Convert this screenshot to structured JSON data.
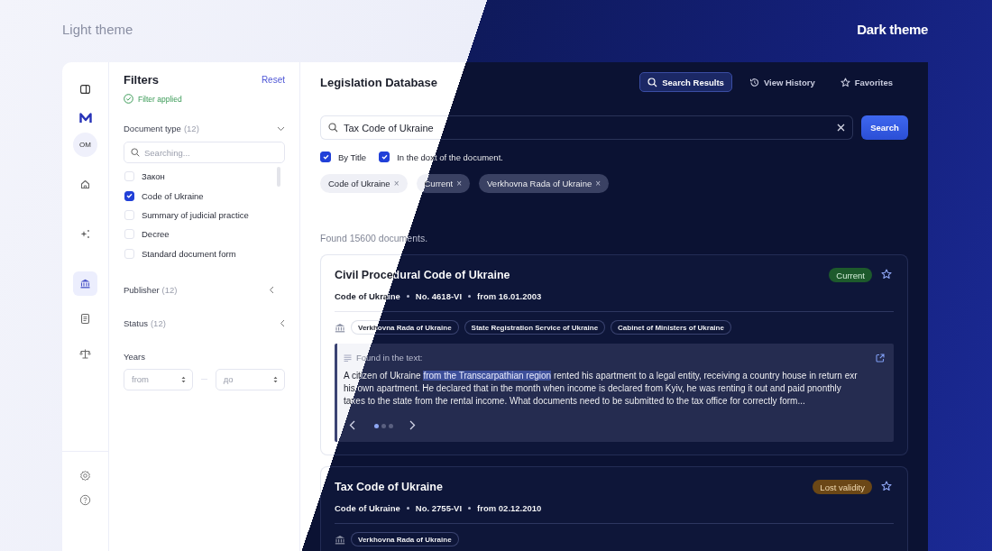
{
  "theme_labels": [
    "Light theme",
    "Dark theme"
  ],
  "rail": {
    "avatar": "OM",
    "nav": [
      {
        "kind": "home",
        "selected": false
      },
      {
        "kind": "sparkle",
        "selected": false
      },
      {
        "kind": "bank",
        "selected": true
      },
      {
        "kind": "document",
        "selected": false
      },
      {
        "kind": "scales",
        "selected": false
      }
    ],
    "bottom": [
      {
        "kind": "settings"
      },
      {
        "kind": "help"
      }
    ]
  },
  "filters": {
    "title": "Filters",
    "reset": "Reset",
    "status": "Filter applied",
    "sections": [
      {
        "title": "Document type",
        "count": "(12)",
        "expanded": true,
        "placeholder": "Searching...",
        "options": [
          {
            "label": "Закон",
            "checked": false
          },
          {
            "label": "Code of Ukraine",
            "checked": true
          },
          {
            "label": "Summary of judicial practice",
            "checked": false
          },
          {
            "label": "Decree",
            "checked": false
          },
          {
            "label": "Standard document form",
            "checked": false
          }
        ]
      },
      {
        "title": "Publisher",
        "count": "(12)",
        "expanded": false
      },
      {
        "title": "Status",
        "count": "(12)",
        "expanded": false
      }
    ],
    "years": {
      "title": "Years",
      "from": "from",
      "to": "до"
    }
  },
  "main": {
    "title": "Legislation Database",
    "tabs": [
      {
        "label": "Search Results",
        "kind": "search",
        "selected": true
      },
      {
        "label": "View History",
        "kind": "history",
        "selected": false
      },
      {
        "label": "Favorites",
        "kind": "star",
        "selected": false
      }
    ],
    "search": {
      "value": "Tax Code of Ukraine",
      "button": "Search"
    },
    "scopes": [
      {
        "label": "By Title",
        "checked": true
      },
      {
        "label": "In the doxt of the document.",
        "checked": true
      }
    ],
    "chips": [
      {
        "label": "Code of Ukraine",
        "remove": "×"
      },
      {
        "label": "Current",
        "remove": "×"
      },
      {
        "label": "Verkhovna Rada of Ukraine",
        "remove": "×"
      }
    ],
    "found": "Found 15600 documents.",
    "results": [
      {
        "title": "Civil Procedural Code of Ukraine",
        "status": "Current",
        "kind": "valid",
        "meta": [
          "Code of Ukraine",
          "No. 4618-VI",
          "from 16.01.2003"
        ],
        "publishers": [
          "Verkhovna Rada of Ukraine",
          "State Registration Service of Ukraine",
          "Cabinet of Ministers of Ukraine"
        ],
        "excerpt": {
          "heading": "Found in the text:",
          "before": "A citizen of Ukraine ",
          "highlight": "from the Transcarpathian region",
          "after": " rented his apartment to a legal entity, receiving a country house in return exr his own apartment. He declared that in the month when income is declared from Kyiv, he was renting it out and paid pnonthly taxes to the state from the rental income. What documents need to be submitted to the tax office for correctly form...",
          "pages": [
            {
              "selected": true
            },
            {
              "selected": false
            },
            {
              "selected": false
            }
          ]
        }
      },
      {
        "title": "Tax Code of Ukraine",
        "status": "Lost validity",
        "kind": "invalid",
        "meta": [
          "Code of Ukraine",
          "No. 2755-VI",
          "from 02.12.2010"
        ],
        "publishers": [
          "Verkhovna Rada of Ukraine"
        ]
      }
    ]
  }
}
